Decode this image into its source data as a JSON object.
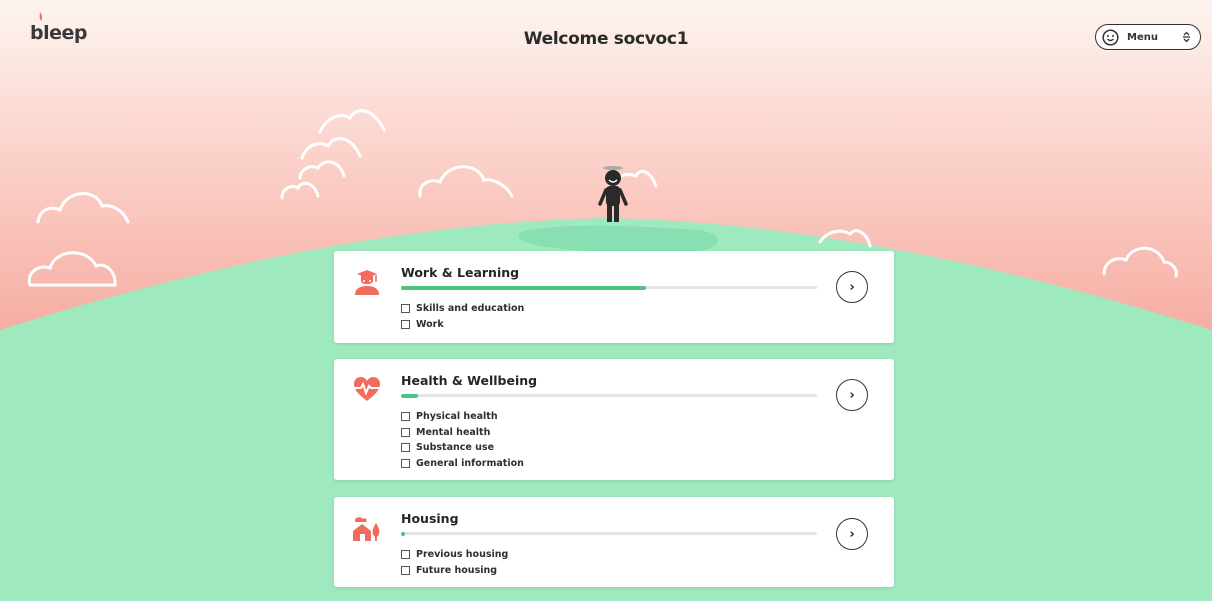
{
  "header": {
    "logo_text": "bleep",
    "title": "Welcome socvoc1",
    "menu_label": "Menu"
  },
  "categories": [
    {
      "title": "Work & Learning",
      "icon": "graduate-icon",
      "progress": 0.59,
      "items": [
        "Skills and education",
        "Work"
      ],
      "go_label": "›"
    },
    {
      "title": "Health & Wellbeing",
      "icon": "heartbeat-icon",
      "progress": 0.04,
      "items": [
        "Physical health",
        "Mental health",
        "Substance use",
        "General information"
      ],
      "go_label": "›"
    },
    {
      "title": "Housing",
      "icon": "house-icon",
      "progress": 0.01,
      "items": [
        "Previous housing",
        "Future housing"
      ],
      "go_label": "›"
    }
  ],
  "colors": {
    "accent": "#f26b5b",
    "progress": "#49c584",
    "sky_top": "#fde8e2",
    "sky_bottom": "#f59a8f",
    "hill": "#9fe9bf"
  }
}
